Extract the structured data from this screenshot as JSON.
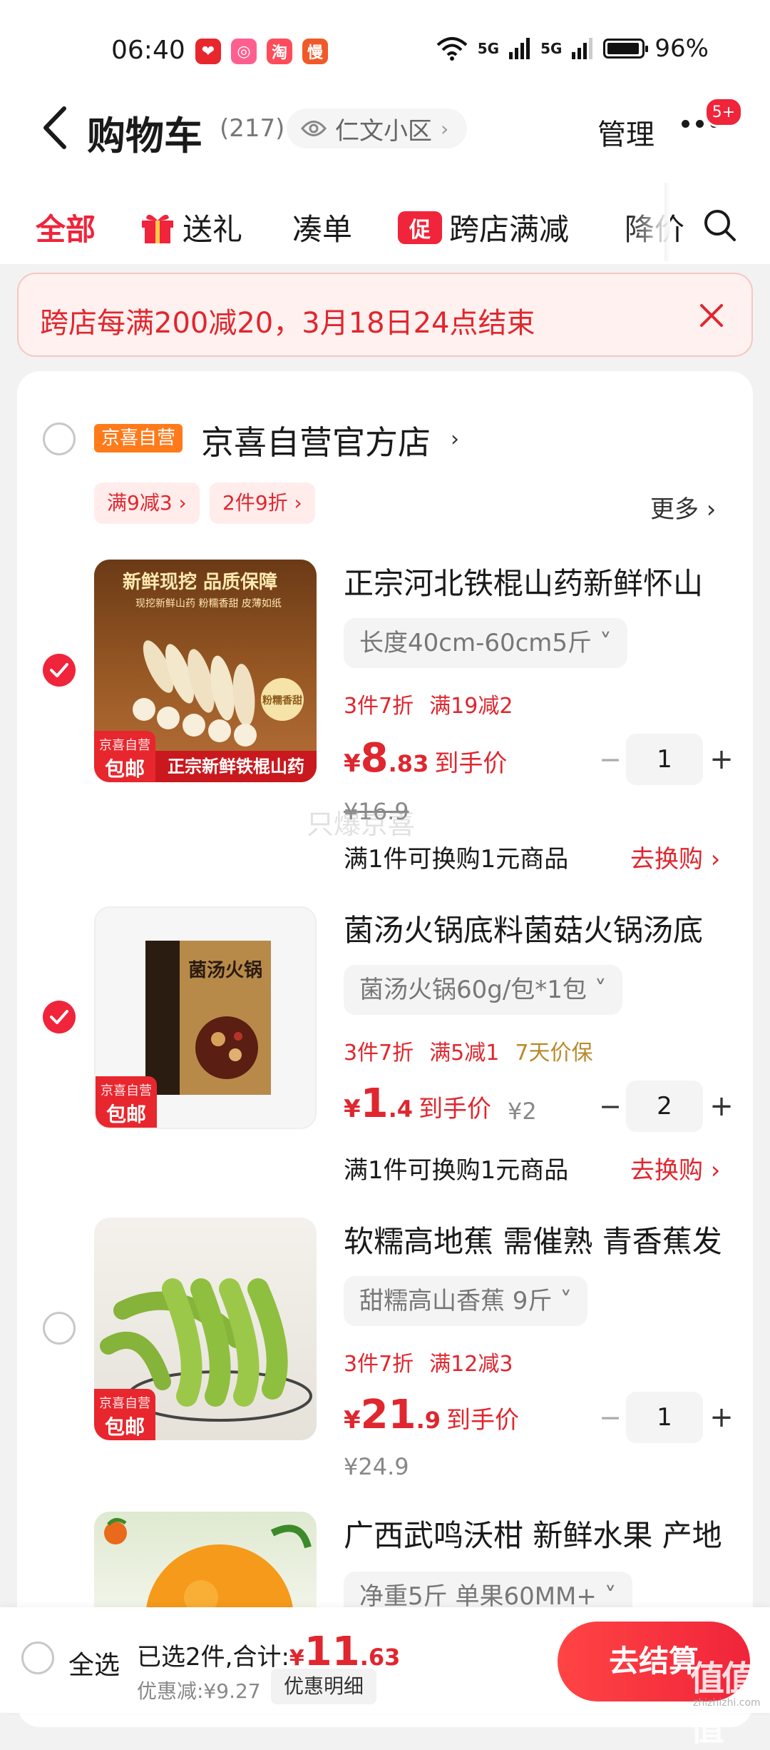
{
  "status_bar": {
    "time": "06:40",
    "apps": [
      {
        "icon": "app-icon-red",
        "glyph": "❤",
        "color": "#e8262d"
      },
      {
        "icon": "app-icon-pink",
        "glyph": "◎",
        "color": "#ff5f8f"
      },
      {
        "icon": "app-icon-taobao",
        "glyph": "淘",
        "color": "#ff4c5a"
      },
      {
        "icon": "app-icon-orange",
        "glyph": "慢",
        "color": "#f05a28"
      }
    ],
    "signal_1": "5G",
    "signal_2": "5G",
    "battery": "96%"
  },
  "header": {
    "title": "购物车",
    "count": "(217)",
    "location": "仁文小区",
    "manage": "管理",
    "message_badge": "5+"
  },
  "tabs": [
    {
      "label": "全部",
      "active": true
    },
    {
      "label": "送礼",
      "icon": "gift-icon"
    },
    {
      "label": "凑单"
    },
    {
      "label": "跨店满减",
      "tag": "促"
    },
    {
      "label": "降价"
    }
  ],
  "notice": {
    "text": "跨店每满200减20，3月18日24点结束"
  },
  "store": {
    "tag": "京喜自营",
    "name": "京喜自营官方店",
    "coupons": [
      "满9减3 ›",
      "2件9折 ›"
    ],
    "more": "更多 ›"
  },
  "products": [
    {
      "title": "正宗河北铁棍山药新鲜怀山",
      "spec": "长度40cm-60cm5斤 ˅",
      "promos": [
        "3件7折",
        "满19减2"
      ],
      "price_currency": "¥",
      "price_int": "8",
      "price_dec": ".83",
      "price_suffix": "到手价",
      "orig_price": "¥16.9",
      "qty": "1",
      "checked": true,
      "exchange": "满1件可换购1元商品",
      "exchange_link": "去换购 ›",
      "badge_top": "京喜自营",
      "badge_bottom": "包邮",
      "img_text_top": "新鲜现挖 品质保障",
      "img_text_sub": "现挖新鲜山药 粉糯香甜 皮薄如纸",
      "img_text_bottom": "正宗新鲜铁棍山药",
      "img_text_seal": "粉糯香甜"
    },
    {
      "title": "菌汤火锅底料菌菇火锅汤底",
      "spec": "菌汤火锅60g/包*1包 ˅",
      "promos": [
        "3件7折",
        "满5减1",
        "7天价保"
      ],
      "price_currency": "¥",
      "price_int": "1",
      "price_dec": ".4",
      "price_suffix": "到手价",
      "orig_price": "¥2",
      "qty": "2",
      "checked": true,
      "exchange": "满1件可换购1元商品",
      "exchange_link": "去换购 ›",
      "badge_top": "京喜自营",
      "badge_bottom": "包邮",
      "img_text_pack": "菌汤火锅"
    },
    {
      "title": "软糯高地蕉 需催熟 青香蕉发",
      "spec": "甜糯高山香蕉 9斤 ˅",
      "promos": [
        "3件7折",
        "满12减3"
      ],
      "price_currency": "¥",
      "price_int": "21",
      "price_dec": ".9",
      "price_suffix": "到手价",
      "orig_price": "¥24.9",
      "qty": "1",
      "checked": false,
      "badge_top": "京喜自营",
      "badge_bottom": "包邮"
    },
    {
      "title": "广西武鸣沃柑 新鲜水果 产地",
      "spec": "净重5斤 单果60MM+ ˅",
      "checked": false
    }
  ],
  "watermark": "只爆京喜",
  "bottom_bar": {
    "select_all": "全选",
    "selected_label": "已选2件,合计:",
    "total_currency": "¥",
    "total_int": "11",
    "total_dec": ".63",
    "discount": "优惠减:¥9.27",
    "detail": "优惠明细",
    "checkout": "去结算",
    "corner_mark": "值值值",
    "corner_mark_sub": "zhizhizhi.com"
  },
  "colors": {
    "accent": "#f0243a",
    "store_tag": "#ff7a1a",
    "gold": "#b88a2a"
  }
}
